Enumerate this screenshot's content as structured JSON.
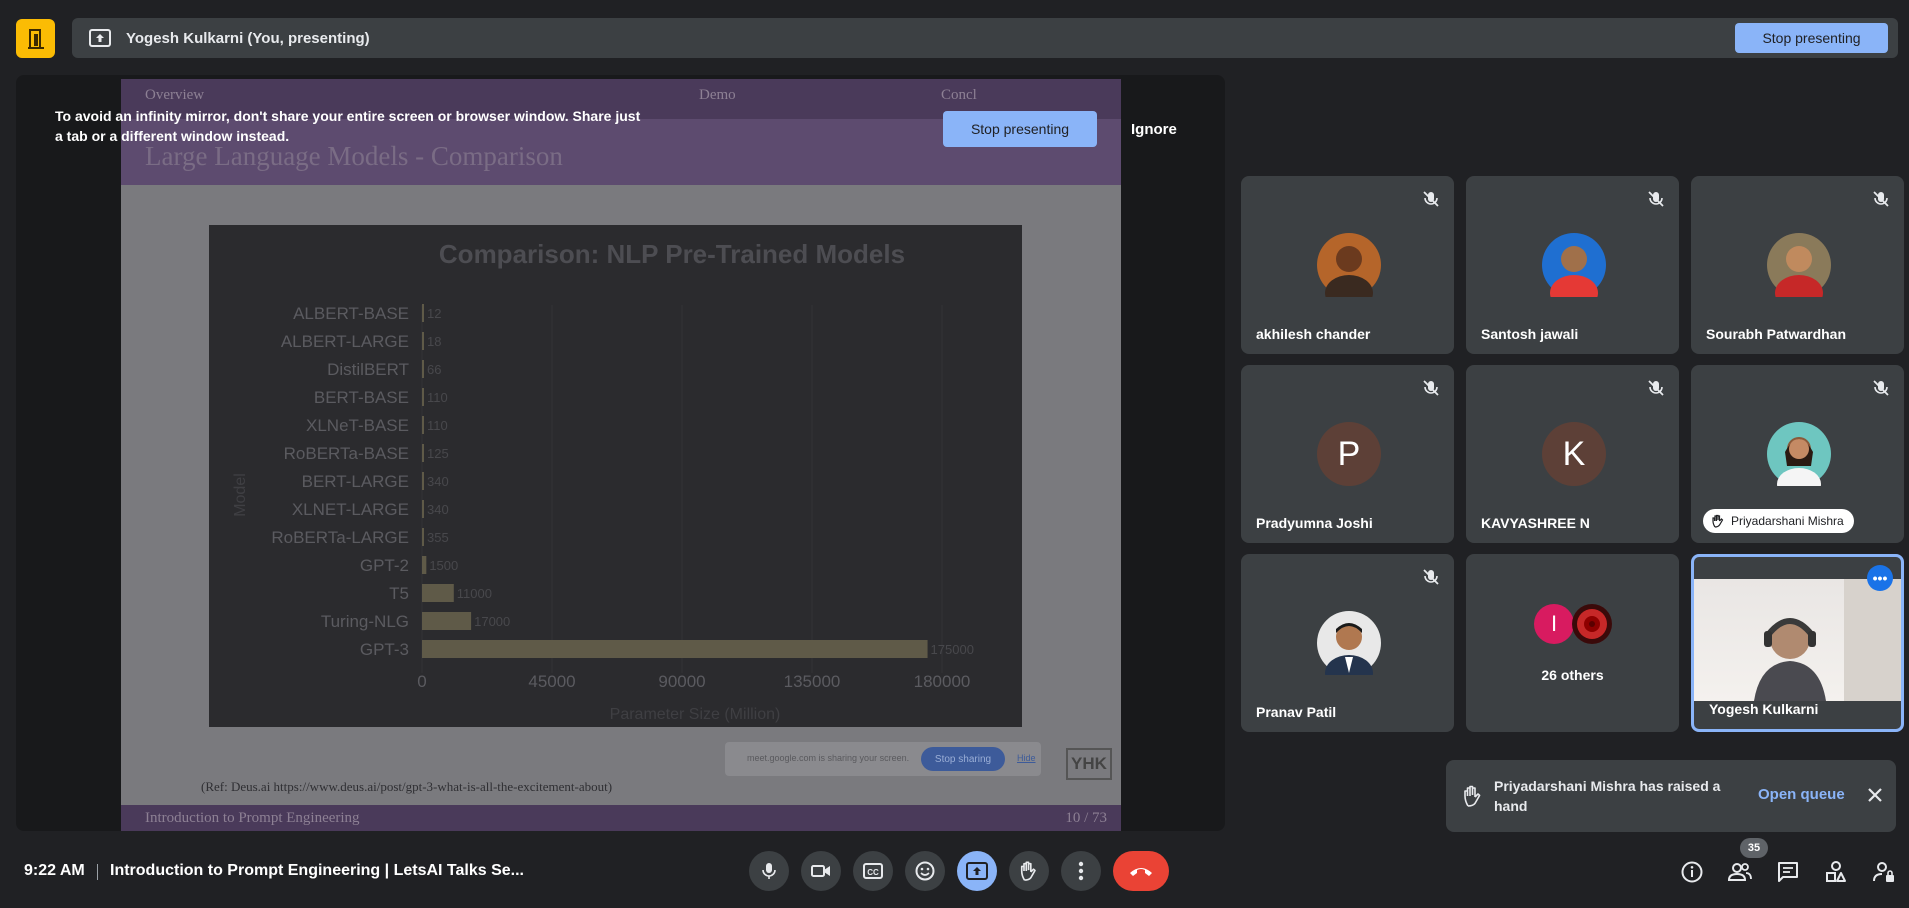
{
  "top_bar": {
    "presenter_text": "Yogesh Kulkarni (You, presenting)",
    "stop_label": "Stop presenting"
  },
  "warning": {
    "text": "To avoid an infinity mirror, don't share your entire screen or browser window. Share just a tab or a different window instead.",
    "stop_label": "Stop presenting",
    "ignore_label": "Ignore"
  },
  "slide": {
    "nav": [
      "Overview",
      "Demo",
      "Concl"
    ],
    "title": "Large Language Models - Comparison",
    "ref": "(Ref:  Deus.ai https://www.deus.ai/post/gpt-3-what-is-all-the-excitement-about)",
    "footer_left": "Introduction to Prompt Engineering",
    "footer_right": "10 / 73",
    "logo": "YHK",
    "share_text": "meet.google.com is sharing your screen.",
    "share_stop": "Stop sharing",
    "share_hide": "Hide"
  },
  "chart_data": {
    "type": "bar",
    "orientation": "horizontal",
    "title": "Comparison: NLP Pre-Trained Models",
    "xlabel": "Parameter Size (Million)",
    "ylabel": "Model",
    "categories": [
      "ALBERT-BASE",
      "ALBERT-LARGE",
      "DistilBERT",
      "BERT-BASE",
      "XLNeT-BASE",
      "RoBERTa-BASE",
      "BERT-LARGE",
      "XLNET-LARGE",
      "RoBERTa-LARGE",
      "GPT-2",
      "T5",
      "Turing-NLG",
      "GPT-3"
    ],
    "values": [
      12,
      18,
      66,
      110,
      110,
      125,
      340,
      340,
      355,
      1500,
      11000,
      17000,
      175000
    ],
    "xticks": [
      "0",
      "45000",
      "90000",
      "135000",
      "180000"
    ],
    "xlim": [
      0,
      180000
    ]
  },
  "participants": [
    {
      "name": "akhilesh chander",
      "muted": true,
      "avatar": "photo",
      "color": "#b5652a"
    },
    {
      "name": "Santosh jawali",
      "muted": true,
      "avatar": "photo",
      "color": "#1f6fd1"
    },
    {
      "name": "Sourabh Patwardhan",
      "muted": true,
      "avatar": "photo",
      "color": "#8a7a5a"
    },
    {
      "name": "Pradyumna Joshi",
      "muted": true,
      "avatar": "P",
      "color": "#5d4037"
    },
    {
      "name": "KAVYASHREE N",
      "muted": true,
      "avatar": "K",
      "color": "#5d4037"
    },
    {
      "name": "Priyadarshani Mishra",
      "muted": true,
      "avatar": "photo",
      "color": "#6ec6c0"
    },
    {
      "name": "Pranav Patil",
      "muted": true,
      "avatar": "photo",
      "color": "#e8e8e8"
    }
  ],
  "others": {
    "initial": "I",
    "label": "26 others"
  },
  "self": {
    "name": "Yogesh Kulkarni"
  },
  "toast": {
    "message": "Priyadarshani Mishra has raised a hand",
    "action": "Open queue"
  },
  "bottom": {
    "time": "9:22 AM",
    "meeting_title": "Introduction to Prompt Engineering | LetsAI Talks Se...",
    "people_count": "35"
  }
}
